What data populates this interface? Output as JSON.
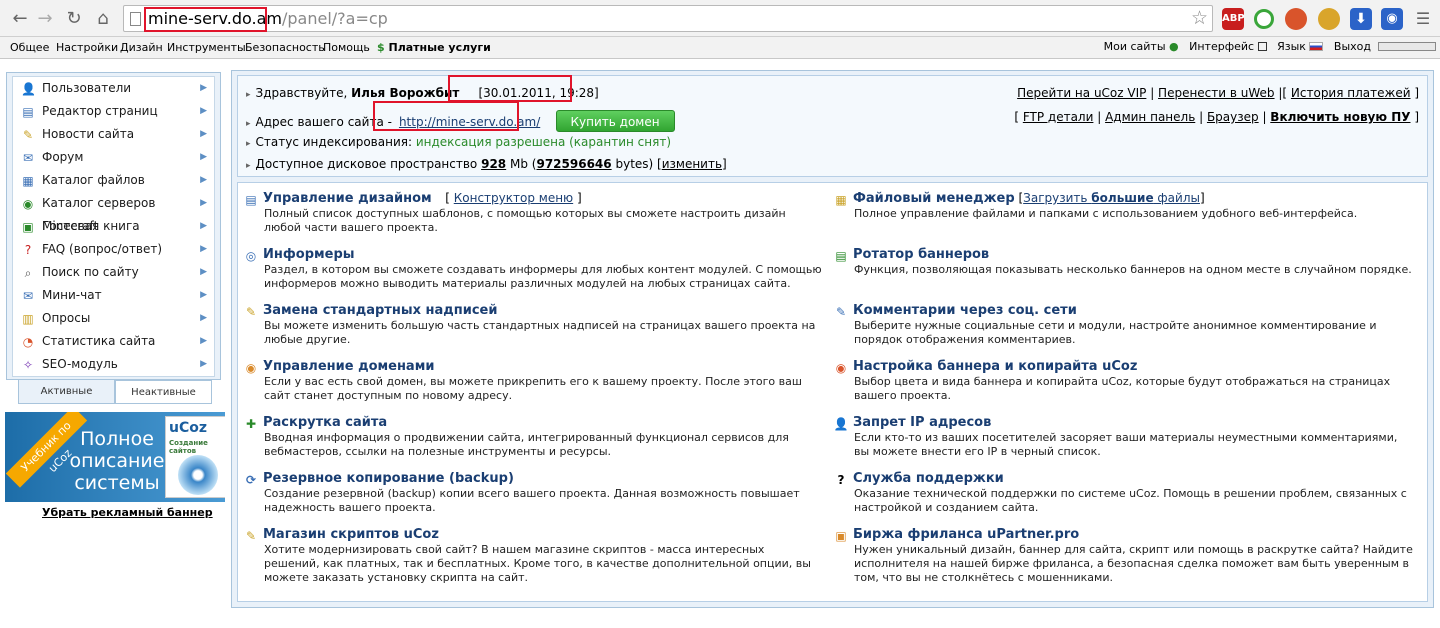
{
  "browser": {
    "url_host": "mine-serv.do.am",
    "url_path": "/panel/?a=cp",
    "nav": {
      "back": "←",
      "forward": "→",
      "reload": "↻",
      "home": "⌂"
    },
    "ext_abp": "ABP"
  },
  "bookmarks": {
    "items": [
      "Общее",
      "Настройки",
      "Дизайн",
      "Инструменты",
      "Безопасность",
      "Помощь"
    ],
    "paid": "Платные услуги",
    "my_sites": "Мои сайты",
    "interface": "Интерфейс",
    "language": "Язык",
    "logout": "Выход"
  },
  "sidebar": {
    "items": [
      {
        "label": "Пользователи",
        "icon": "users-icon"
      },
      {
        "label": "Редактор страниц",
        "icon": "pages-icon"
      },
      {
        "label": "Новости сайта",
        "icon": "news-icon"
      },
      {
        "label": "Форум",
        "icon": "forum-icon"
      },
      {
        "label": "Каталог файлов",
        "icon": "files-icon"
      },
      {
        "label": "Каталог серверов Minecraft",
        "icon": "globe-icon"
      },
      {
        "label": "Гостевая книга",
        "icon": "guestbook-icon"
      },
      {
        "label": "FAQ (вопрос/ответ)",
        "icon": "faq-icon"
      },
      {
        "label": "Поиск по сайту",
        "icon": "search-icon"
      },
      {
        "label": "Мини-чат",
        "icon": "chat-icon"
      },
      {
        "label": "Опросы",
        "icon": "polls-icon"
      },
      {
        "label": "Статистика сайта",
        "icon": "stats-icon"
      },
      {
        "label": "SEO-модуль",
        "icon": "seo-icon"
      }
    ],
    "tab_active": "Активные",
    "tab_inactive": "Неактивные"
  },
  "banner": {
    "ribbon": "Учебник по uCoz",
    "text": "Полное описание системы",
    "book_title": "uCoz",
    "book_sub": "Создание сайтов",
    "remove": "Убрать рекламный баннер"
  },
  "info": {
    "greeting": "Здравствуйте,",
    "user": "Илья Ворожбит",
    "datetime": "[30.01.2011, 19:28]",
    "vip": "Перейти на uCoz VIP",
    "uweb": "Перенести в uWeb",
    "history": "История платежей",
    "site_label": "Адрес вашего сайта -",
    "site_url": "http://mine-serv.do.am/",
    "buy_domain": "Купить домен",
    "ftp": "FTP детали",
    "admin": "Админ панель",
    "browser": "Браузер",
    "new_pu": "Включить новую ПУ",
    "index_label": "Статус индексирования:",
    "index_value": "индексация разрешена (карантин снят)",
    "disk_label": "Доступное дисковое пространство",
    "disk_mb": "928",
    "disk_mb_unit": "Mb",
    "disk_bytes": "972596646",
    "disk_bytes_unit": "bytes",
    "change": "изменить"
  },
  "tools_left": [
    {
      "title": "Управление дизайном",
      "extra": "Конструктор меню",
      "desc": "Полный список доступных шаблонов, с помощью которых вы сможете настроить дизайн любой части вашего проекта."
    },
    {
      "title": "Информеры",
      "extra": "",
      "desc": "Раздел, в котором вы сможете создавать информеры для любых контент модулей. С помощью информеров можно выводить материалы различных модулей на любых страницах сайта."
    },
    {
      "title": "Замена стандартных надписей",
      "extra": "",
      "desc": "Вы можете изменить большую часть стандартных надписей на страницах вашего проекта на любые другие."
    },
    {
      "title": "Управление доменами",
      "extra": "",
      "desc": "Если у вас есть свой домен, вы можете прикрепить его к вашему проекту. После этого ваш сайт станет доступным по новому адресу."
    },
    {
      "title": "Раскрутка сайта",
      "extra": "",
      "desc": "Вводная информация о продвижении сайта, интегрированный функционал сервисов для вебмастеров, ссылки на полезные инструменты и ресурсы."
    },
    {
      "title": "Резервное копирование (backup)",
      "extra": "",
      "desc": "Создание резервной (backup) копии всего вашего проекта. Данная возможность повышает надежность вашего проекта."
    },
    {
      "title": "Магазин скриптов uCoz",
      "extra": "",
      "desc": "Хотите модернизировать свой сайт? В нашем магазине скриптов - масса интересных решений, как платных, так и бесплатных. Кроме того, в качестве дополнительной опции, вы можете заказать установку скрипта на сайт."
    }
  ],
  "tools_right": [
    {
      "title": "Файловый менеджер",
      "extra_a": "Загрузить ",
      "extra_b": "большие",
      "extra_c": " файлы",
      "desc": "Полное управление файлами и папками с использованием удобного веб-интерфейса."
    },
    {
      "title": "Ротатор баннеров",
      "desc": "Функция, позволяющая показывать несколько баннеров на одном месте в случайном порядке."
    },
    {
      "title": "Комментарии через соц. сети",
      "desc": "Выберите нужные социальные сети и модули, настройте анонимное комментирование и порядок отображения комментариев."
    },
    {
      "title": "Настройка баннера и копирайта uCoz",
      "desc": "Выбор цвета и вида баннера и копирайта uCoz, которые будут отображаться на страницах вашего проекта."
    },
    {
      "title": "Запрет IP адресов",
      "desc": "Если кто-то из ваших посетителей засоряет ваши материалы неуместными комментариями, вы можете внести его IP в черный список."
    },
    {
      "title": "Служба поддержки",
      "desc": "Оказание технической поддержки по системе uCoz. Помощь в решении проблем, связанных с настройкой и созданием сайта."
    },
    {
      "title": "Биржа фриланса uPartner.pro",
      "desc": "Нужен уникальный дизайн, баннер для сайта, скрипт или помощь в раскрутке сайта? Найдите исполнителя на нашей бирже фриланса, а безопасная сделка поможет вам быть уверенным в том, что вы не столкнётесь с мошенниками."
    }
  ],
  "colors": {
    "highlight": "#e0142b",
    "link": "#1a3e72",
    "panel_border": "#a8c4dc",
    "index_ok": "#2a8a2a"
  }
}
